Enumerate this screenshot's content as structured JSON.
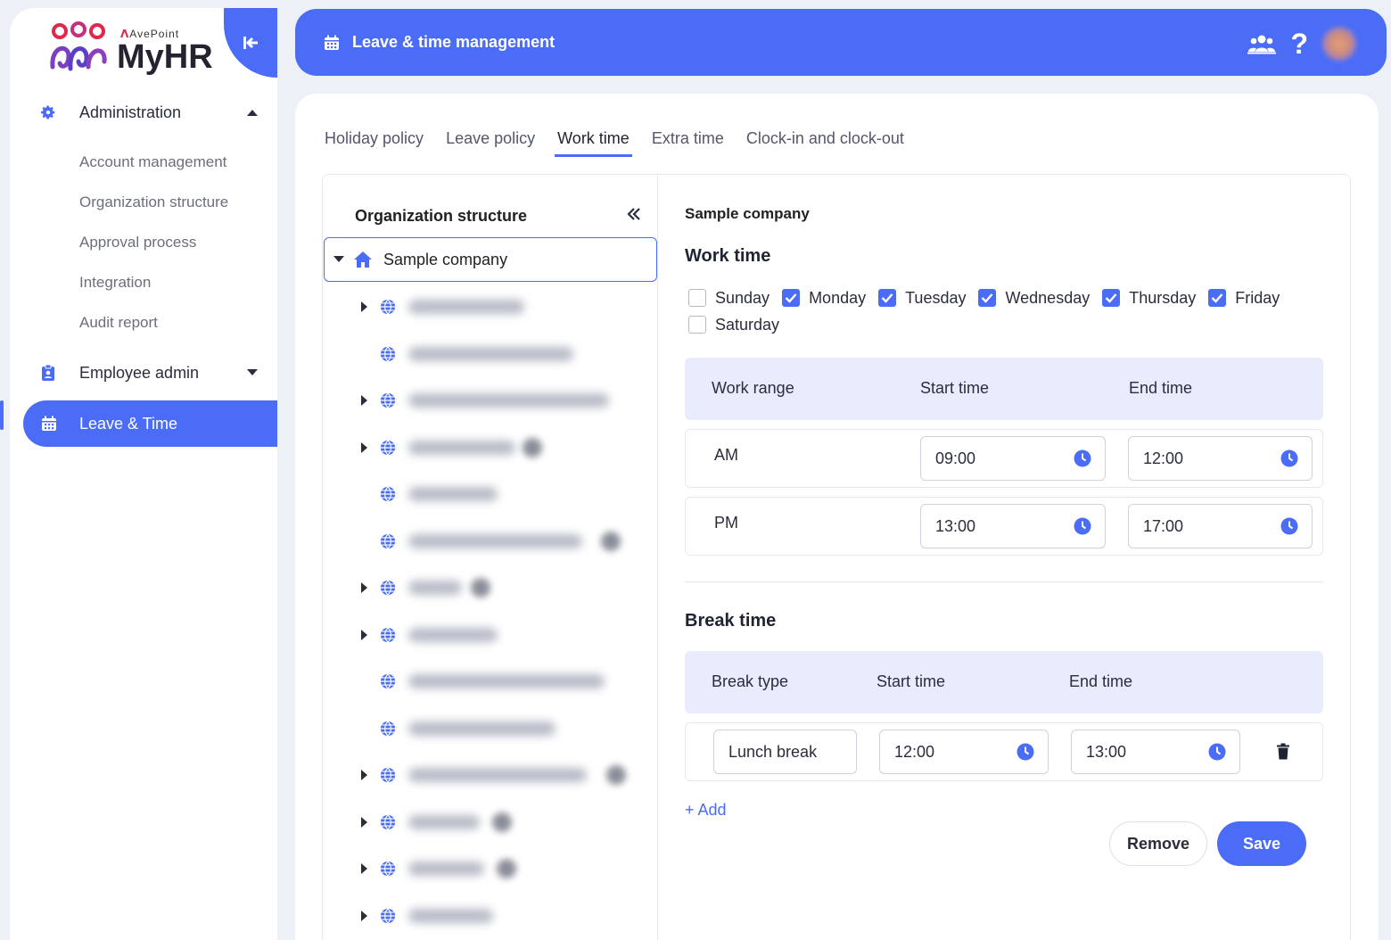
{
  "app": {
    "brand_sub": "AvePoint",
    "brand_main": "MyHR"
  },
  "sidebar": {
    "administration": {
      "label": "Administration",
      "items": [
        "Account management",
        "Organization structure",
        "Approval process",
        "Integration",
        "Audit report"
      ]
    },
    "employee_admin": {
      "label": "Employee admin"
    },
    "leave_time": {
      "label": "Leave & Time"
    }
  },
  "header": {
    "title": "Leave & time management",
    "help": "?"
  },
  "tabs": [
    "Holiday policy",
    "Leave policy",
    "Work time",
    "Extra time",
    "Clock-in and clock-out"
  ],
  "active_tab": "Work time",
  "org_tree": {
    "title": "Organization structure",
    "root": "Sample company"
  },
  "panel": {
    "company": "Sample company",
    "work_time_title": "Work time",
    "days": [
      {
        "label": "Sunday",
        "checked": false
      },
      {
        "label": "Monday",
        "checked": true
      },
      {
        "label": "Tuesday",
        "checked": true
      },
      {
        "label": "Wednesday",
        "checked": true
      },
      {
        "label": "Thursday",
        "checked": true
      },
      {
        "label": "Friday",
        "checked": true
      },
      {
        "label": "Saturday",
        "checked": false
      }
    ],
    "work_table": {
      "headers": [
        "Work range",
        "Start time",
        "End time"
      ],
      "rows": [
        {
          "range": "AM",
          "start": "09:00",
          "end": "12:00"
        },
        {
          "range": "PM",
          "start": "13:00",
          "end": "17:00"
        }
      ]
    },
    "break_time_title": "Break time",
    "break_table": {
      "headers": [
        "Break type",
        "Start time",
        "End time"
      ],
      "rows": [
        {
          "type": "Lunch break",
          "start": "12:00",
          "end": "13:00"
        }
      ]
    },
    "add_label": "+ Add",
    "remove_label": "Remove",
    "save_label": "Save"
  },
  "colors": {
    "accent": "#4a6cf7",
    "header_bg": "#e8ecfd",
    "page_bg": "#eef0f7"
  }
}
